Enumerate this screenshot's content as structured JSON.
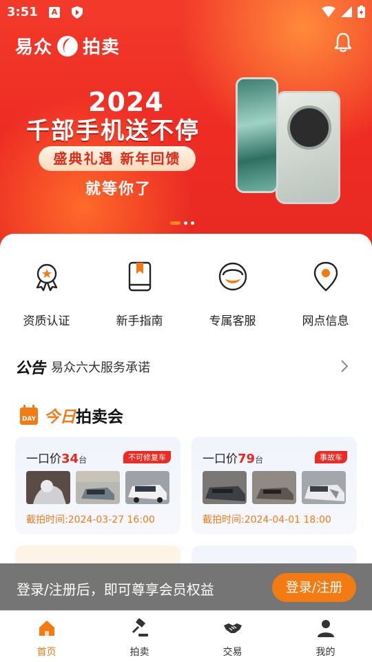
{
  "status_bar": {
    "time": "3:51",
    "a_badge": "A"
  },
  "header": {
    "logo_left": "易众",
    "logo_right": "拍卖"
  },
  "banner": {
    "year": "2024",
    "title": "千部手机送不停",
    "pill": "盛典礼遇 新年回馈",
    "subtitle": "就等你了",
    "slide_count": 3,
    "active_slide": 1
  },
  "quick_links": [
    {
      "label": "资质认证",
      "icon": "certificate-icon"
    },
    {
      "label": "新手指南",
      "icon": "guide-book-icon"
    },
    {
      "label": "专属客服",
      "icon": "customer-service-icon"
    },
    {
      "label": "网点信息",
      "icon": "location-pin-icon"
    }
  ],
  "notice": {
    "tag": "公告",
    "text": "易众六大服务承诺"
  },
  "today": {
    "day_badge": "DAY",
    "title_part1": "今日",
    "title_part2": "拍卖会"
  },
  "cards": [
    {
      "prefix": "一口价",
      "count": "34",
      "unit": "台",
      "tag": "不可修复车",
      "time": "截拍时间:2024-03-27 16:00"
    },
    {
      "prefix": "一口价",
      "count": "79",
      "unit": "台",
      "tag": "事故车",
      "time": "截拍时间:2024-04-01 18:00"
    }
  ],
  "login_prompt": {
    "text": "登录/注册后，即可尊享会员权益",
    "button": "登录/注册"
  },
  "tabs": [
    {
      "label": "首页",
      "icon": "home-icon",
      "active": true
    },
    {
      "label": "拍卖",
      "icon": "gavel-icon",
      "active": false
    },
    {
      "label": "交易",
      "icon": "handshake-icon",
      "active": false
    },
    {
      "label": "我的",
      "icon": "user-icon",
      "active": false
    }
  ],
  "colors": {
    "brand_red": "#ee2c24",
    "accent_orange": "#f47a12",
    "tag_red": "#ee2b22"
  }
}
